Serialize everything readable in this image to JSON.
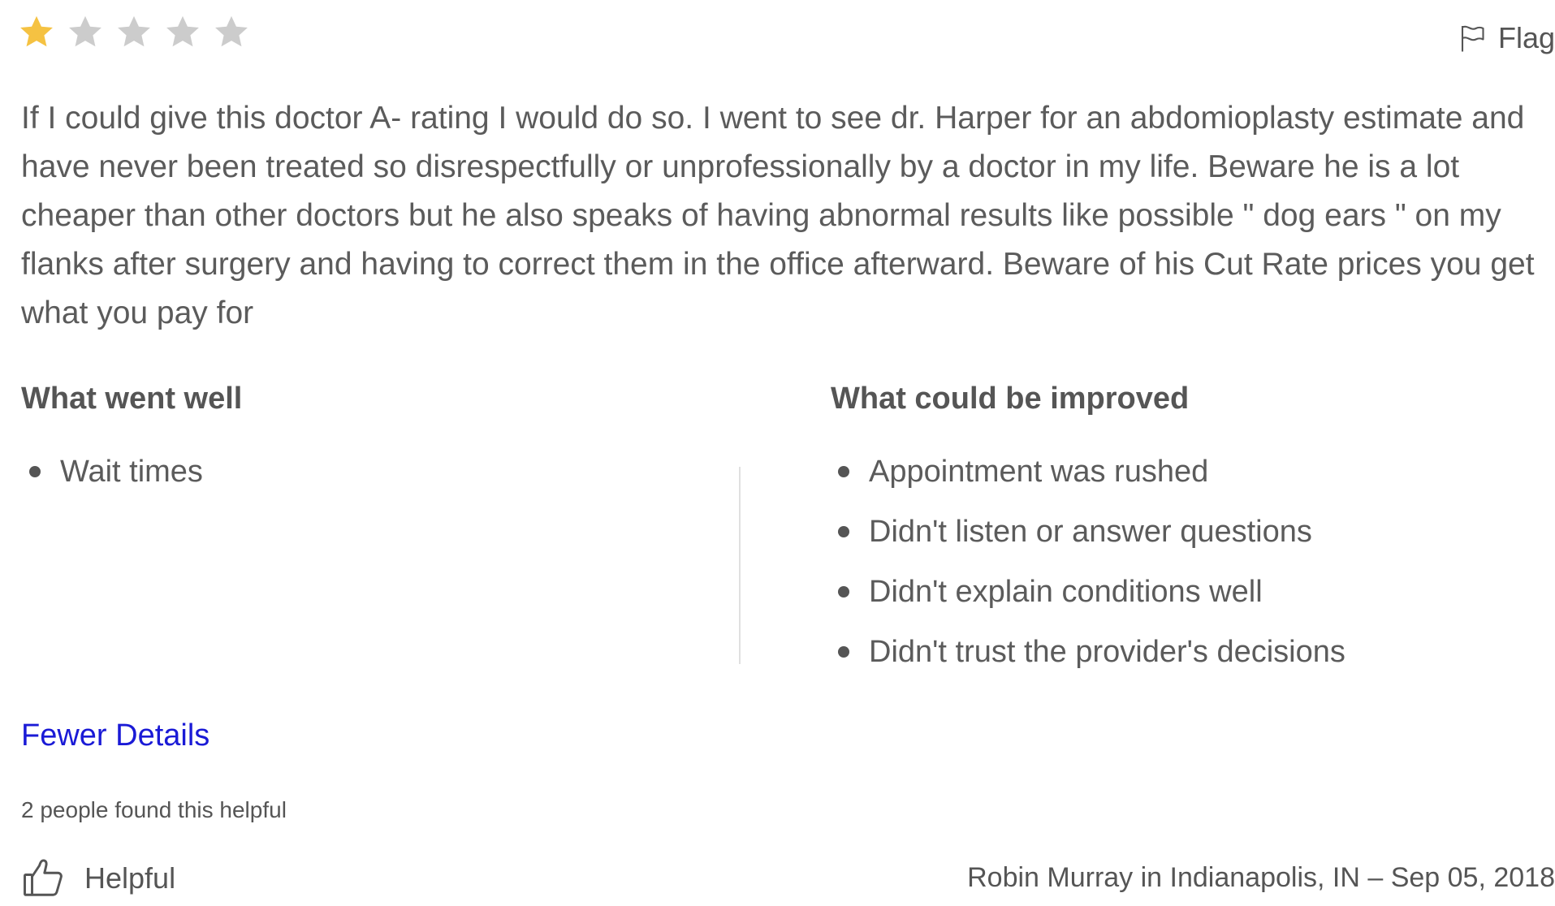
{
  "rating": {
    "value": 1,
    "max": 5,
    "filled_color": "#F5C242",
    "empty_color": "#CCCCCC"
  },
  "flag": {
    "icon": "flag-icon",
    "label": "Flag"
  },
  "review": {
    "text": "If I could give this doctor A- rating I would do so. I went to see dr. Harper for an abdomioplasty estimate and have never been treated so disrespectfully or unprofessionally by a doctor in my life. Beware he is a lot cheaper than other doctors but he also speaks of having abnormal results like possible \" dog ears \" on my flanks after surgery and having to correct them in the office afterward. Beware of his Cut Rate prices you get what you pay for"
  },
  "went_well": {
    "heading": "What went well",
    "items": [
      "Wait times"
    ]
  },
  "could_improve": {
    "heading": "What could be improved",
    "items": [
      "Appointment was rushed",
      "Didn't listen or answer questions",
      "Didn't explain conditions well",
      "Didn't trust the provider's decisions"
    ]
  },
  "details_toggle": {
    "label": "Fewer Details",
    "color": "#1A1AD6"
  },
  "helpful_count_text": "2 people found this helpful",
  "helpful_button": {
    "icon": "thumbs-up-icon",
    "label": "Helpful"
  },
  "byline": "Robin Murray in Indianapolis, IN – Sep 05, 2018"
}
